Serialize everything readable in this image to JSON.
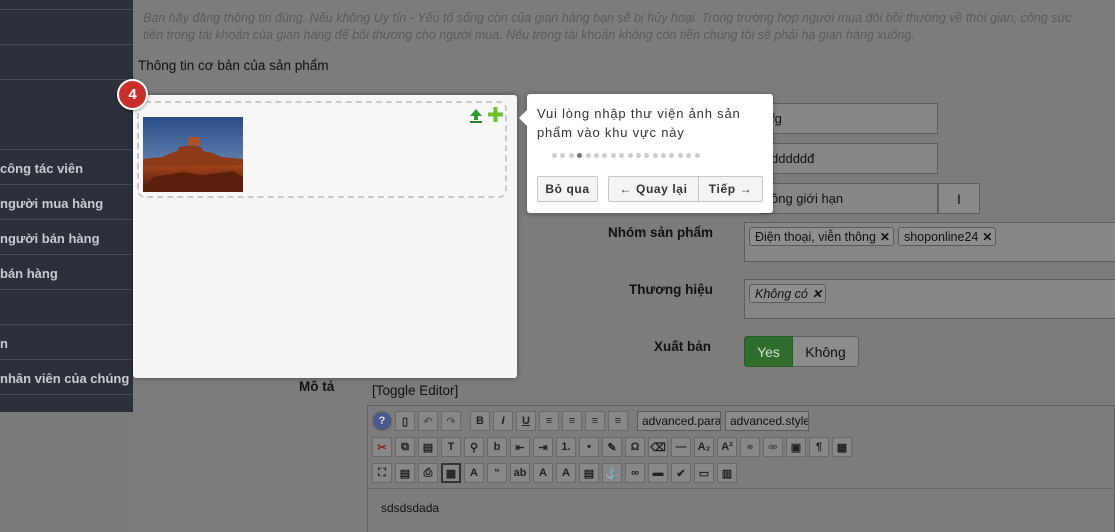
{
  "sidebar": {
    "items": [
      {
        "label": ""
      },
      {
        "label": ""
      },
      {
        "label": ""
      },
      {
        "label": ""
      },
      {
        "label": "công tác viên"
      },
      {
        "label": "người mua hàng"
      },
      {
        "label": "người bán hàng"
      },
      {
        "label": "bán hàng"
      },
      {
        "label": ""
      },
      {
        "label": "n"
      },
      {
        "label": "nhân viên của chúng"
      }
    ]
  },
  "notice": {
    "line1": "Bạn hãy đăng thông tin đúng. Nếu không Uy tín - Yếu tố sống còn của gian hàng bạn sẽ bị hủy hoại. Trong trường hợp người mua đòi bồi thường về thời gian, công sức",
    "line2": "tiền trong tài khoản của gian hàng để bồi thường cho người mua. Nếu trong tài khoản không còn tiền chúng tôi sẽ phải hạ gian hàng xuống."
  },
  "section_title": "Thông tin cơ bản của sản phẩm",
  "fields": {
    "field1_value": "fg",
    "field2_value": "dddddđ",
    "field3_value": "ông giới hạn",
    "i_button": "I"
  },
  "labels": {
    "product_group": "Nhóm sản phẩm",
    "brand": "Thương hiệu",
    "publish": "Xuất bản",
    "description": "Mô tả"
  },
  "product_group_tags": [
    "Điện thoại, viễn thông",
    "shoponline24"
  ],
  "brand_tags": [
    "Không có"
  ],
  "publish_toggle": {
    "yes": "Yes",
    "no": "Không",
    "selected": "Yes"
  },
  "toggle_editor": "[Toggle Editor]",
  "editor": {
    "paragraph_select": "advanced.para",
    "style_select": "advanced.style",
    "content": "sdsdsdada"
  },
  "tour": {
    "step": "4",
    "text": "Vui lòng nhập thư viện ảnh sản phẩm vào khu vực này",
    "total_steps": 18,
    "current_step_index": 3,
    "skip": "Bỏ qua",
    "back": "← Quay lại",
    "next": "Tiếp →"
  },
  "colors": {
    "badge": "#c9302c",
    "sidebar": "#2b303a",
    "toggle_yes": "#2e6d2c"
  }
}
